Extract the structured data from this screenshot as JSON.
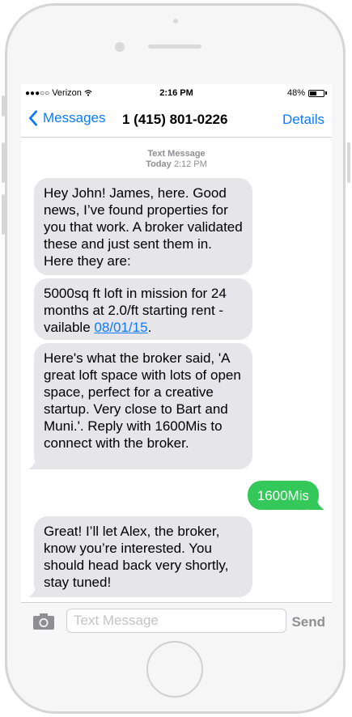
{
  "status_bar": {
    "signal": "●●●○○",
    "carrier": "Verizon",
    "time": "2:16 PM",
    "battery_text": "48%",
    "battery_level": 0.48
  },
  "nav": {
    "back_label": "Messages",
    "title": "1 (415) 801-0226",
    "details_label": "Details"
  },
  "thread": {
    "header_type": "Text Message",
    "header_day": "Today",
    "header_time": "2:12 PM",
    "messages": [
      {
        "from": "them",
        "text": "Hey John! James, here. Good news, I’ve found properties for you that work. A broker validated these and just sent them in. Here they are:"
      },
      {
        "from": "them",
        "text_before": "5000sq ft loft in mission for 24 months at 2.0/ft starting rent - vailable ",
        "link": "08/01/15",
        "text_after": "."
      },
      {
        "from": "them",
        "text": "Here's what the broker said, 'A great loft space with lots of open space, perfect for a creative startup. Very close to Bart and Muni.'. Reply with 1600Mis to connect with the broker."
      },
      {
        "from": "me",
        "text": "1600Mis"
      },
      {
        "from": "them",
        "text": "Great! I’ll let Alex, the broker, know you’re interested. You should head back very shortly, stay tuned!"
      }
    ]
  },
  "composer": {
    "placeholder": "Text Message",
    "send_label": "Send"
  },
  "colors": {
    "ios_blue": "#0a7aff",
    "received_bubble": "#e5e5ea",
    "sent_bubble": "#34c759"
  }
}
